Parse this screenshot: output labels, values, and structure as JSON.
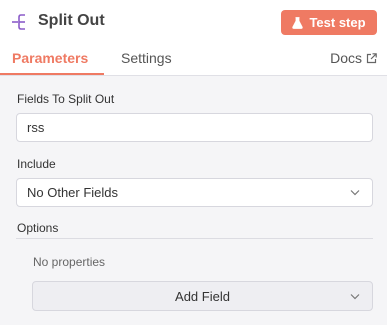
{
  "header": {
    "title": "Split Out",
    "icon": "split-out-icon",
    "test_button_label": "Test step",
    "accent_color": "#ef7a63"
  },
  "tabs": {
    "parameters": "Parameters",
    "settings": "Settings",
    "docs": "Docs"
  },
  "fields": {
    "split_label": "Fields To Split Out",
    "split_value": "rss",
    "include_label": "Include",
    "include_value": "No Other Fields"
  },
  "options": {
    "label": "Options",
    "empty_text": "No properties",
    "add_field_label": "Add Field"
  }
}
